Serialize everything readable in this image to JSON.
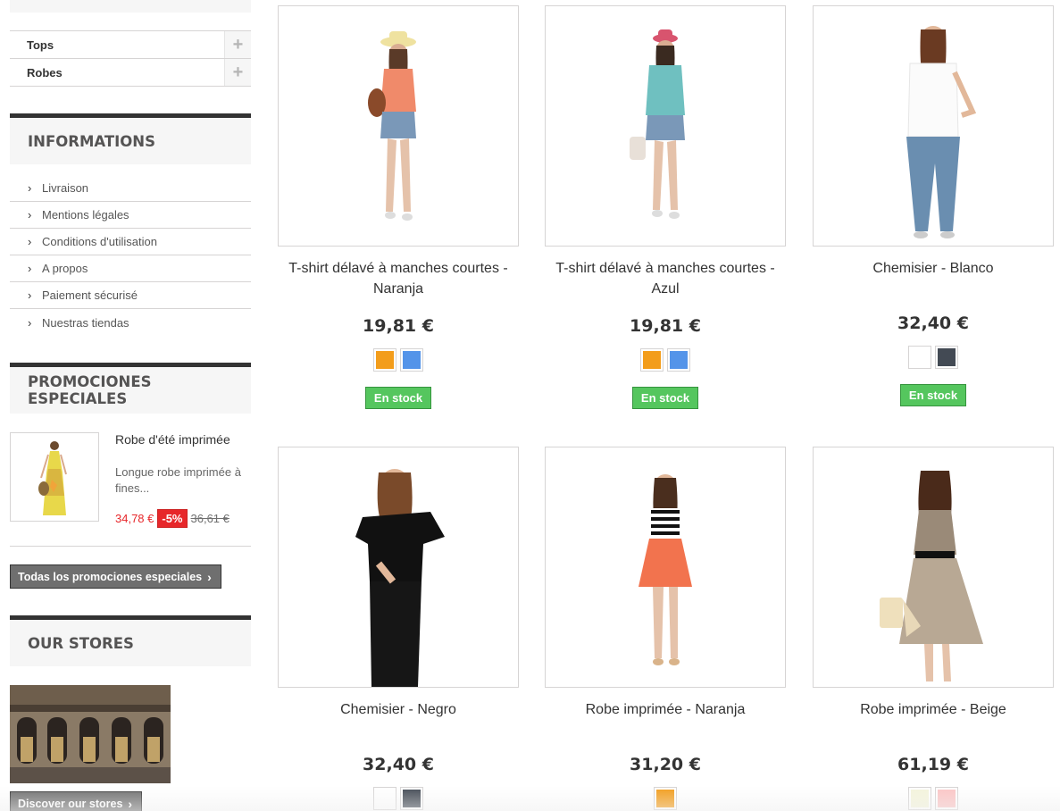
{
  "categories": [
    {
      "label": "Tops"
    },
    {
      "label": "Robes"
    }
  ],
  "informations": {
    "title": "INFORMATIONS",
    "items": [
      "Livraison",
      "Mentions légales",
      "Conditions d'utilisation",
      "A propos",
      "Paiement sécurisé",
      "Nuestras tiendas"
    ]
  },
  "specials": {
    "title": "PROMOCIONES ESPECIALES",
    "product_name": "Robe d'été imprimée",
    "description": "Longue robe imprimée à fines...",
    "price": "34,78 €",
    "reduction": "-5%",
    "old_price": "36,61 €",
    "all_button": "Todas los promociones especiales"
  },
  "stores": {
    "title": "OUR STORES",
    "button": "Discover our stores"
  },
  "products": [
    {
      "name": "T-shirt délavé à manches courtes - Naranja",
      "price": "19,81 €",
      "colors": [
        "#f39d1b",
        "#5494e9"
      ],
      "stock": "En stock"
    },
    {
      "name": "T-shirt délavé à manches courtes - Azul",
      "price": "19,81 €",
      "colors": [
        "#f39d1b",
        "#5494e9"
      ],
      "stock": "En stock"
    },
    {
      "name": "Chemisier - Blanco",
      "price": "32,40 €",
      "colors": [
        "#ffffff",
        "#434a54"
      ],
      "stock": "En stock"
    },
    {
      "name": "Chemisier - Negro",
      "price": "32,40 €",
      "colors": [
        "#ffffff",
        "#434a54"
      ],
      "stock": ""
    },
    {
      "name": "Robe imprimée - Naranja",
      "price": "31,20 €",
      "colors": [
        "#f39d1b"
      ],
      "stock": ""
    },
    {
      "name": "Robe imprimée - Beige",
      "price": "61,19 €",
      "colors": [
        "#f5f5dc",
        "#fcc5c5"
      ],
      "stock": ""
    }
  ]
}
